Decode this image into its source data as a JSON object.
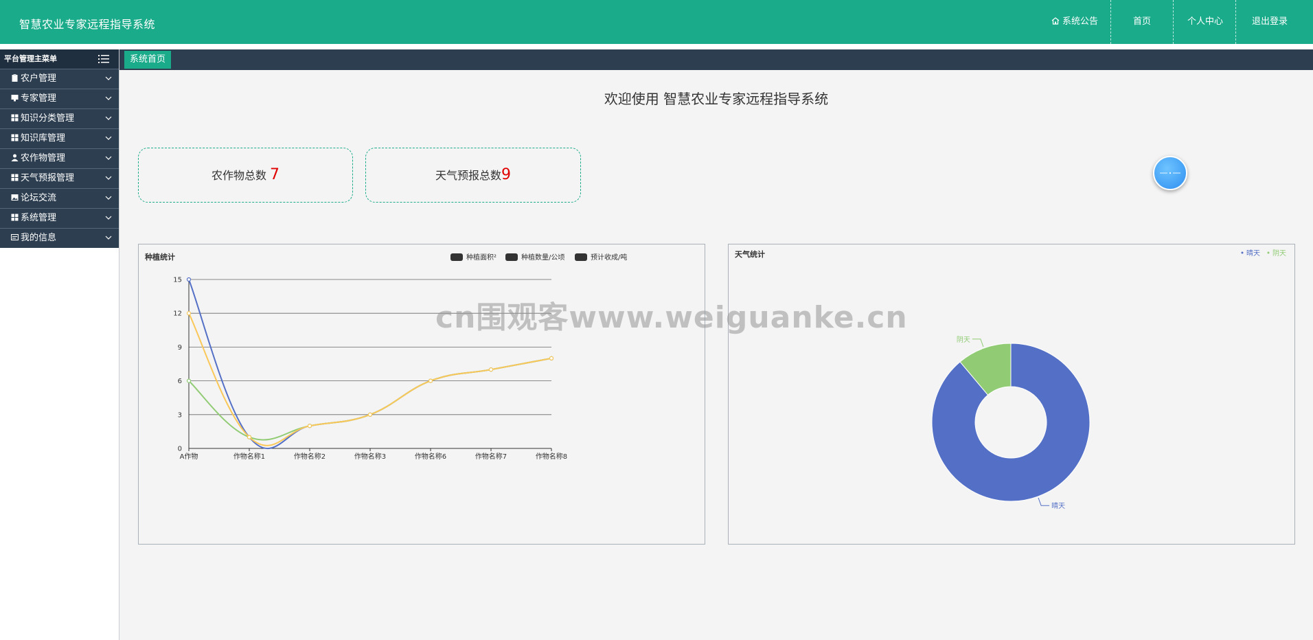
{
  "header": {
    "title": "智慧农业专家远程指导系统",
    "nav": [
      {
        "label": "系统公告",
        "icon": "home-icon"
      },
      {
        "label": "首页"
      },
      {
        "label": "个人中心"
      },
      {
        "label": "退出登录"
      }
    ]
  },
  "sidebar": {
    "title": "平台管理主菜单",
    "items": [
      {
        "label": "农户管理",
        "icon": "clipboard-icon"
      },
      {
        "label": "专家管理",
        "icon": "monitor-icon"
      },
      {
        "label": "知识分类管理",
        "icon": "grid-icon"
      },
      {
        "label": "知识库管理",
        "icon": "grid-icon"
      },
      {
        "label": "农作物管理",
        "icon": "user-icon"
      },
      {
        "label": "天气预报管理",
        "icon": "grid-icon"
      },
      {
        "label": "论坛交流",
        "icon": "image-icon"
      },
      {
        "label": "系统管理",
        "icon": "grid-icon"
      },
      {
        "label": "我的信息",
        "icon": "card-icon"
      }
    ]
  },
  "tabs": [
    {
      "label": "系统首页"
    }
  ],
  "main": {
    "welcome": "欢迎使用 智慧农业专家远程指导系统",
    "cards": [
      {
        "label": "农作物总数",
        "value": "7"
      },
      {
        "label": "天气预报总数",
        "value": "9"
      }
    ]
  },
  "watermark": "cn围观客www.weiguanke.cn",
  "colors": {
    "primary": "#1aab8a",
    "dark": "#2c3e50",
    "series_blue": "#5470c6",
    "series_green": "#91cc75",
    "series_yellow": "#fac858"
  },
  "chart_data": [
    {
      "type": "line",
      "title": "种植统计",
      "categories": [
        "A作物",
        "作物名称1",
        "作物名称2",
        "作物名称3",
        "作物名称6",
        "作物名称7",
        "作物名称8"
      ],
      "series": [
        {
          "name": "种植面积²",
          "values": [
            15,
            1,
            2,
            3,
            6,
            7,
            8
          ]
        },
        {
          "name": "种植数量/公顷",
          "values": [
            6,
            1,
            2,
            3,
            6,
            7,
            8
          ]
        },
        {
          "name": "预计收成/吨",
          "values": [
            12,
            1,
            2,
            3,
            6,
            7,
            8
          ]
        }
      ],
      "ylim": [
        0,
        15
      ],
      "yticks": [
        0,
        3,
        6,
        9,
        12,
        15
      ],
      "grid": true,
      "legend": "top-right"
    },
    {
      "type": "pie",
      "title": "天气统计",
      "categories": [
        "晴天",
        "阴天"
      ],
      "values": [
        8,
        1
      ],
      "legend": "top-right"
    }
  ]
}
